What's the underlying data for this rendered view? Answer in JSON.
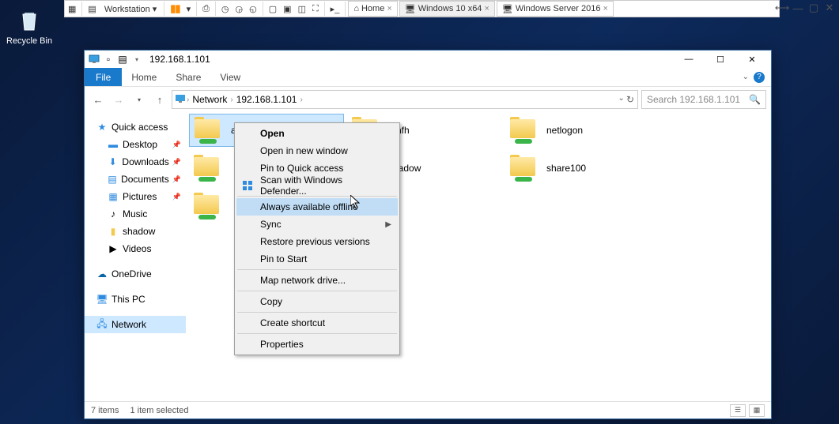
{
  "desktop": {
    "recycle_bin": "Recycle Bin"
  },
  "vmware": {
    "workstation": "Workstation",
    "tabs": {
      "home": "Home",
      "win10": "Windows 10 x64",
      "winserver": "Windows Server 2016"
    }
  },
  "explorer": {
    "title": "192.168.1.101",
    "ribbon": {
      "file": "File",
      "home": "Home",
      "share": "Share",
      "view": "View"
    },
    "breadcrumb": {
      "network": "Network",
      "host": "192.168.1.101"
    },
    "search_placeholder": "Search 192.168.1.101",
    "sidebar": {
      "quick_access": "Quick access",
      "desktop": "Desktop",
      "downloads": "Downloads",
      "documents": "Documents",
      "pictures": "Pictures",
      "music": "Music",
      "shadow": "shadow",
      "videos": "Videos",
      "onedrive": "OneDrive",
      "this_pc": "This PC",
      "network": "Network"
    },
    "folders": {
      "accounts_share": "accounts_share",
      "hfhfh": "hfhfh",
      "netlogon": "netlogon",
      "shadow": "shadow",
      "share100": "share100"
    },
    "status": {
      "count": "7 items",
      "selected": "1 item selected"
    }
  },
  "context_menu": {
    "open": "Open",
    "open_new_window": "Open in new window",
    "pin_quick": "Pin to Quick access",
    "scan_defender": "Scan with Windows Defender...",
    "always_offline": "Always available offline",
    "sync": "Sync",
    "restore_versions": "Restore previous versions",
    "pin_start": "Pin to Start",
    "map_drive": "Map network drive...",
    "copy": "Copy",
    "create_shortcut": "Create shortcut",
    "properties": "Properties"
  }
}
